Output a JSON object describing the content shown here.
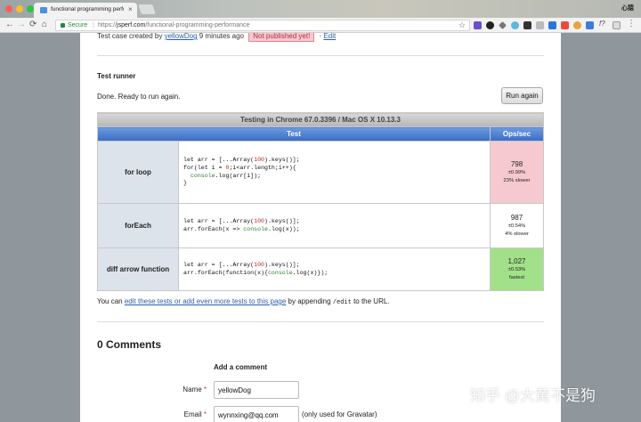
{
  "browser": {
    "tab_title": "functional programming perfo",
    "tab_close": "×",
    "profile_name": "心猿",
    "nav": {
      "back": "←",
      "forward": "→",
      "reload": "⟳",
      "home": "⌂"
    },
    "secure_label": "Secure",
    "url_scheme": "https://",
    "url_host": "jsperf.com",
    "url_path": "/functional-programming-performance",
    "star": "☆",
    "fx_label": "f?",
    "menu": "⋮"
  },
  "page": {
    "meta": {
      "prefix": "Test case created by",
      "author": "yellowDog",
      "time": "9 minutes ago",
      "badge": "Not published yet!",
      "separator": "·",
      "edit_link": "Edit"
    },
    "runner": {
      "title": "Test runner",
      "status": "Done. Ready to run again.",
      "run_button": "Run again"
    },
    "results": {
      "caption": "Testing in Chrome 67.0.3396 / Mac OS X 10.13.3",
      "col_test": "Test",
      "col_ops": "Ops/sec",
      "rows": [
        {
          "name": "for loop",
          "ops": "798",
          "error": "±0.99%",
          "note": "23% slower",
          "bg": "#f5c9cf"
        },
        {
          "name": "forEach",
          "ops": "987",
          "error": "±0.54%",
          "note": "4% slower",
          "bg": "#ffffff"
        },
        {
          "name": "diff arrow function",
          "ops": "1,027",
          "error": "±0.53%",
          "note": "fastest",
          "bg": "#a2e18a"
        }
      ]
    },
    "footer": {
      "prefix": "You can",
      "link": "edit these tests or add even more tests to this page",
      "mid": "by appending",
      "path": "/edit",
      "suffix": "to the URL."
    },
    "comments": {
      "heading": "0 Comments",
      "add_heading": "Add a comment",
      "name_label": "Name",
      "name_value": "yellowDog",
      "email_label": "Email",
      "email_value": "wynnxing@qq.com",
      "email_hint": "(only used for Gravatar)",
      "required_mark": "*"
    }
  },
  "watermark": "知乎 @大黄不是狗"
}
